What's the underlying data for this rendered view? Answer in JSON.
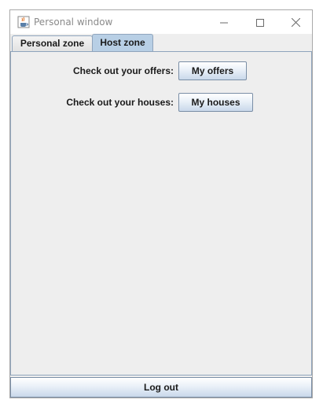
{
  "window": {
    "title": "Personal window",
    "icon": "java-cup-icon",
    "controls": [
      "minimize-icon",
      "maximize-icon",
      "close-icon"
    ]
  },
  "tabs": [
    {
      "label": "Personal zone",
      "selected": false
    },
    {
      "label": "Host zone",
      "selected": true
    }
  ],
  "host_zone": {
    "offers_label": "Check out your offers:",
    "offers_button": "My offers",
    "houses_label": "Check out your houses:",
    "houses_button": "My houses"
  },
  "footer": {
    "logout_label": "Log out"
  },
  "colors": {
    "selected_tab": "#b8cfe5",
    "border": "#8fa4bc",
    "background": "#eeeeee"
  }
}
